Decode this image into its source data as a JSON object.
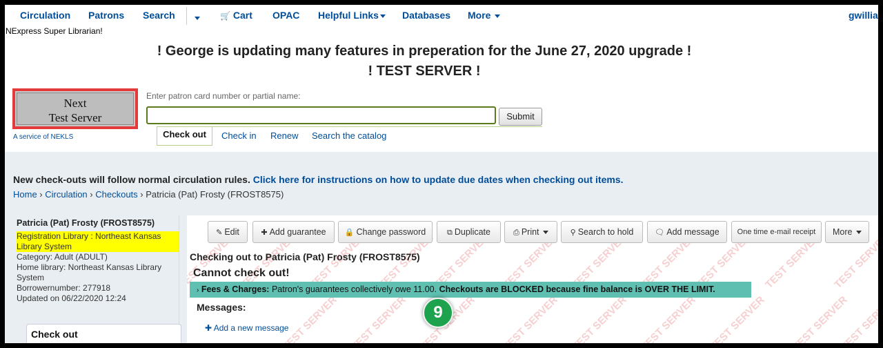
{
  "nav": {
    "items": [
      {
        "label": "Circulation"
      },
      {
        "label": "Patrons"
      },
      {
        "label": "Search"
      },
      {
        "label": "Cart"
      },
      {
        "label": "OPAC"
      },
      {
        "label": "Helpful Links"
      },
      {
        "label": "Databases"
      },
      {
        "label": "More"
      }
    ],
    "user": "gwillia"
  },
  "login_message": "NExpress Super Librarian!",
  "announcement": {
    "line1": "! George is updating many features in preperation for the June 27, 2020 upgrade !",
    "line2": "! TEST SERVER !"
  },
  "logo": {
    "line1": "Next",
    "line2": "Test Server",
    "tagline": "A service of NEKLS"
  },
  "search": {
    "label": "Enter patron card number or partial name:",
    "value": "",
    "submit_label": "Submit"
  },
  "tabs": [
    {
      "label": "Check out"
    },
    {
      "label": "Check in"
    },
    {
      "label": "Renew"
    },
    {
      "label": "Search the catalog"
    }
  ],
  "rules_notice": {
    "text": "New check-outs will follow normal circulation rules.",
    "link": "Click here for instructions on how to update due dates when checking out items."
  },
  "breadcrumb": {
    "home": "Home",
    "circulation": "Circulation",
    "checkouts": "Checkouts",
    "current": "Patricia (Pat) Frosty (FROST8575)"
  },
  "patron": {
    "name": "Patricia (Pat) Frosty (FROST8575)",
    "registration_library": "Registration Library : Northeast Kansas Library System",
    "category": "Category: Adult (ADULT)",
    "home_library": "Home library: Northeast Kansas Library System",
    "borrowernumber": "Borrowernumber: 277918",
    "updated": "Updated on 06/22/2020 12:24"
  },
  "sidebar_box_title": "Check out",
  "toolbar": {
    "edit": "Edit",
    "add_guarantee": "Add guarantee",
    "change_password": "Change password",
    "duplicate": "Duplicate",
    "print": "Print",
    "search_to_hold": "Search to hold",
    "add_message": "Add message",
    "email_receipt": "One time e-mail receipt",
    "more": "More"
  },
  "checkout_panel": {
    "title": "Checking out to Patricia (Pat) Frosty (FROST8575)",
    "cannot": "Cannot check out!",
    "fees_label": "Fees & Charges:",
    "fees_text": "Patron's guarantees collectively owe 11.00.",
    "fees_blocked": "Checkouts are BLOCKED because fine balance is OVER THE LIMIT.",
    "messages_label": "Messages:",
    "add_message": "Add a new message"
  },
  "watermark": "TEST SERVER",
  "step_badge": "9",
  "colors": {
    "link": "#004d99",
    "highlight": "#ffff00",
    "alert": "#5fbfb0",
    "badge": "#1da24d",
    "logo_border": "#e33b3b"
  }
}
